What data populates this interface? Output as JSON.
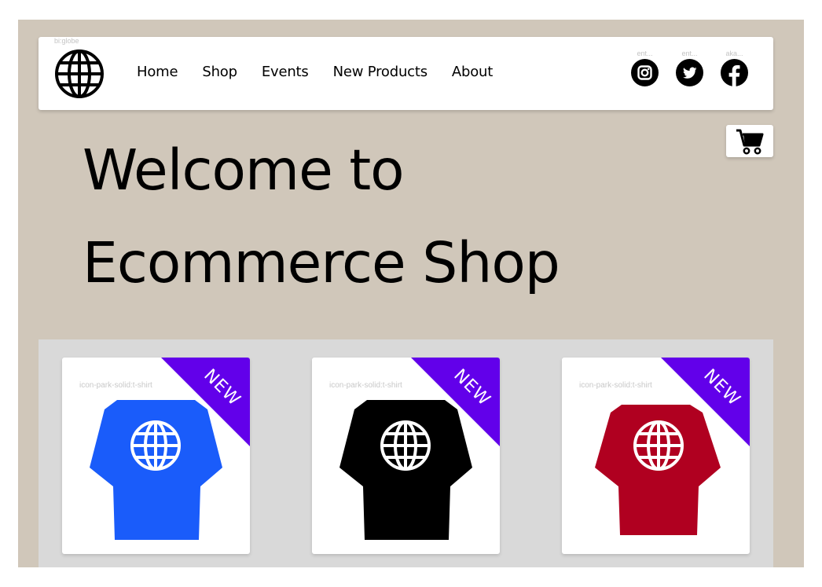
{
  "header": {
    "logo_caption": "bi:globe",
    "logo_icon": "globe-icon",
    "nav": [
      {
        "label": "Home"
      },
      {
        "label": "Shop"
      },
      {
        "label": "Events"
      },
      {
        "label": "New Products"
      },
      {
        "label": "About"
      }
    ],
    "social": [
      {
        "caption": "ent...",
        "icon": "instagram-icon"
      },
      {
        "caption": "ent...",
        "icon": "twitter-icon"
      },
      {
        "caption": "aka...",
        "icon": "facebook-icon"
      }
    ]
  },
  "cart": {
    "icon": "shopping-cart-icon"
  },
  "hero": {
    "line1": "Welcome to",
    "line2": "Ecommerce Shop"
  },
  "products": [
    {
      "caption": "icon-park-solid:t-shirt",
      "badge": "NEW",
      "shirt_color": "#1a5cfa"
    },
    {
      "caption": "icon-park-solid:t-shirt",
      "badge": "NEW",
      "shirt_color": "#000000"
    },
    {
      "caption": "icon-park-solid:t-shirt",
      "badge": "NEW",
      "shirt_color": "#b00020"
    }
  ],
  "colors": {
    "background": "#d0c7ba",
    "product_area": "#d9d9d9",
    "badge": "#6200ea"
  }
}
